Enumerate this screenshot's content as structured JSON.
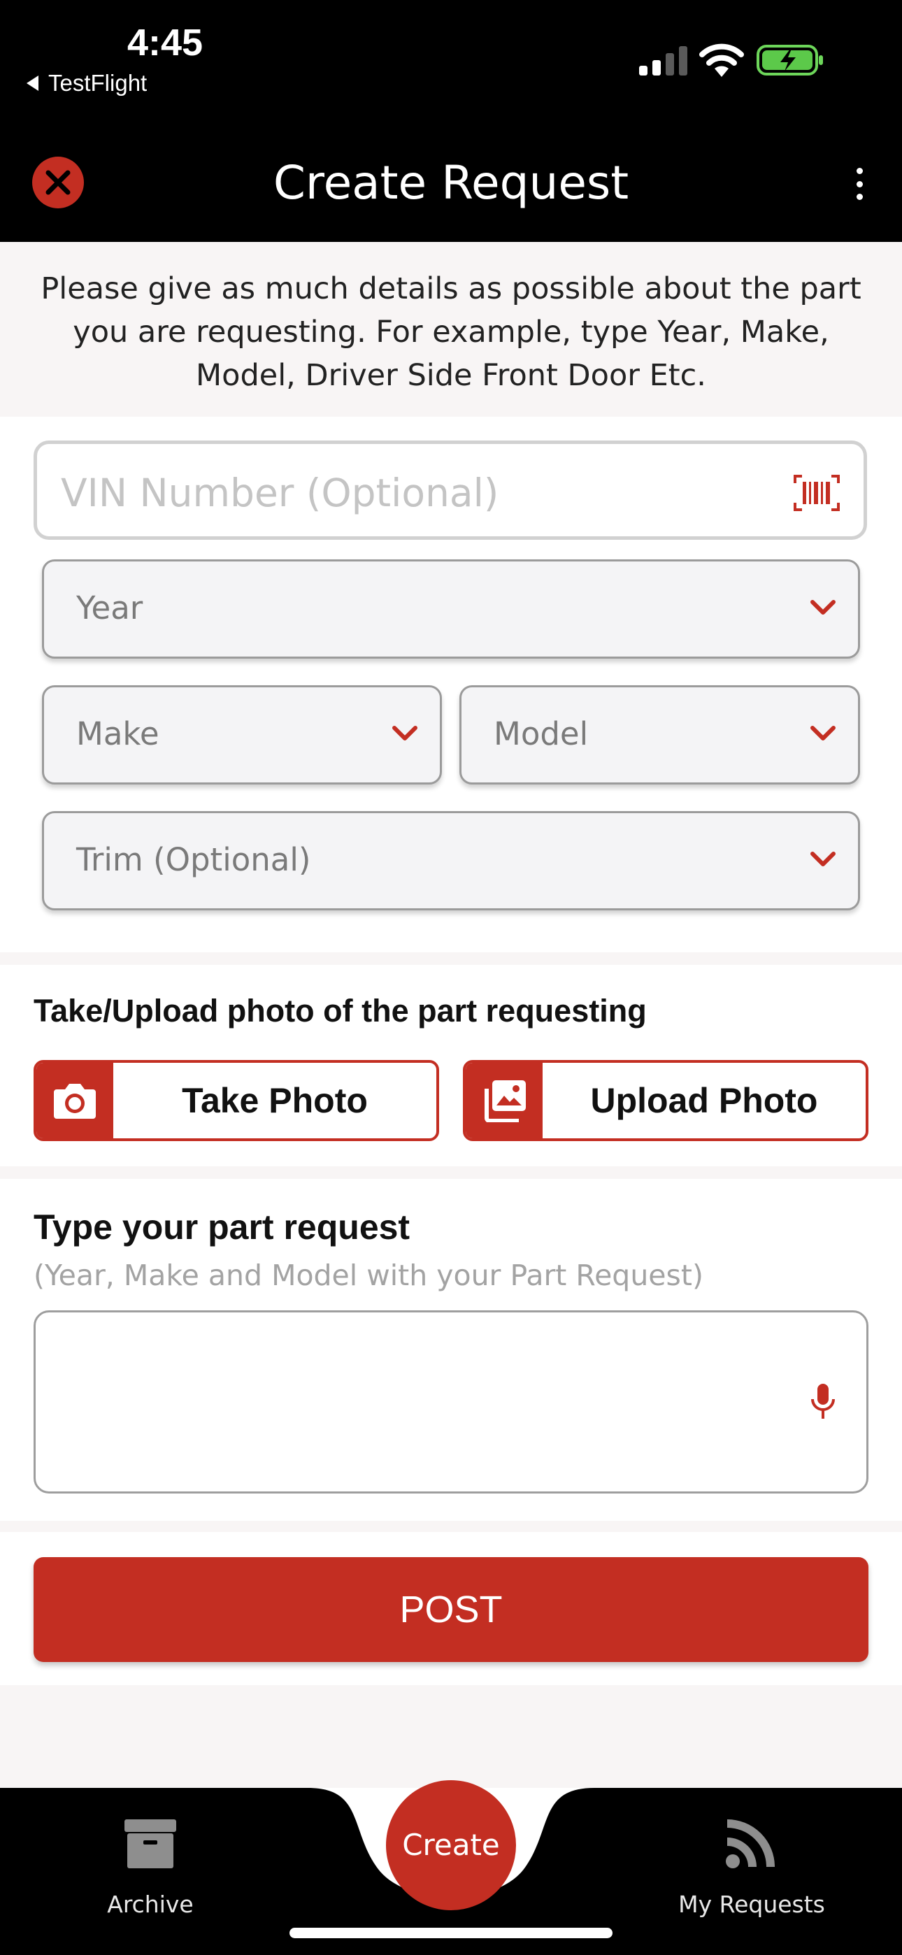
{
  "status_bar": {
    "time": "4:45",
    "back_app": "TestFlight"
  },
  "nav": {
    "title": "Create Request"
  },
  "intro": {
    "text": "Please give as much details as possible about the part you are requesting.  For example, type Year, Make, Model, Driver Side Front Door Etc."
  },
  "form": {
    "vin_placeholder": "VIN Number (Optional)",
    "year_placeholder": "Year",
    "make_placeholder": "Make",
    "model_placeholder": "Model",
    "trim_placeholder": "Trim (Optional)"
  },
  "photo": {
    "heading": "Take/Upload photo of the part requesting",
    "take_label": "Take Photo",
    "upload_label": "Upload Photo"
  },
  "request": {
    "heading": "Type your part request",
    "subheading": "(Year, Make and Model with your Part Request)",
    "value": ""
  },
  "post_label": "POST",
  "tabs": {
    "archive": "Archive",
    "create": "Create",
    "my_requests": "My Requests"
  },
  "colors": {
    "accent": "#c32e22",
    "bar_bg": "#000000",
    "section_bg": "#f8f5f5",
    "placeholder": "#c4c4c4"
  },
  "icons": [
    "close-icon",
    "more-vertical-icon",
    "barcode-icon",
    "chevron-down-icon",
    "camera-icon",
    "image-icon",
    "microphone-icon",
    "archive-icon",
    "rss-feed-icon"
  ]
}
